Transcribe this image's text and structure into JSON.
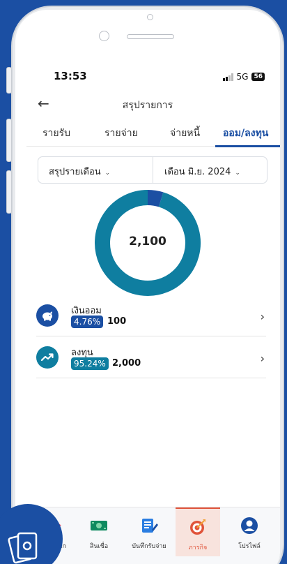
{
  "status": {
    "time": "13:53",
    "network": "5G",
    "battery": "56"
  },
  "header": {
    "title": "สรุปรายการ"
  },
  "tabs": [
    {
      "label": "รายรับ"
    },
    {
      "label": "รายจ่าย"
    },
    {
      "label": "จ่ายหนี้"
    },
    {
      "label": "ออม/ลงทุน"
    }
  ],
  "selectors": {
    "summary_type": "สรุปรายเดือน",
    "month": "เดือน มิ.ย. 2024"
  },
  "chart_data": {
    "type": "pie",
    "total_label": "2,100",
    "categories": [
      "เงินออม",
      "ลงทุน"
    ],
    "values": [
      100,
      2000
    ],
    "colors": [
      "#1b4fa3",
      "#0f7ea0"
    ]
  },
  "items": [
    {
      "label": "เงินออม",
      "percent": "4.76%",
      "value": "100",
      "icon": "piggy-bank-icon",
      "color": "#1b4fa3"
    },
    {
      "label": "ลงทุน",
      "percent": "95.24%",
      "value": "2,000",
      "icon": "trend-up-icon",
      "color": "#0f7ea0"
    }
  ],
  "nav": [
    {
      "label": "หน้าหลัก",
      "icon": "home-icon"
    },
    {
      "label": "สินเชื่อ",
      "icon": "money-icon"
    },
    {
      "label": "บันทึกรับจ่าย",
      "icon": "notebook-icon"
    },
    {
      "label": "ภารกิจ",
      "icon": "target-icon"
    },
    {
      "label": "โปรไฟล์",
      "icon": "profile-icon"
    }
  ]
}
